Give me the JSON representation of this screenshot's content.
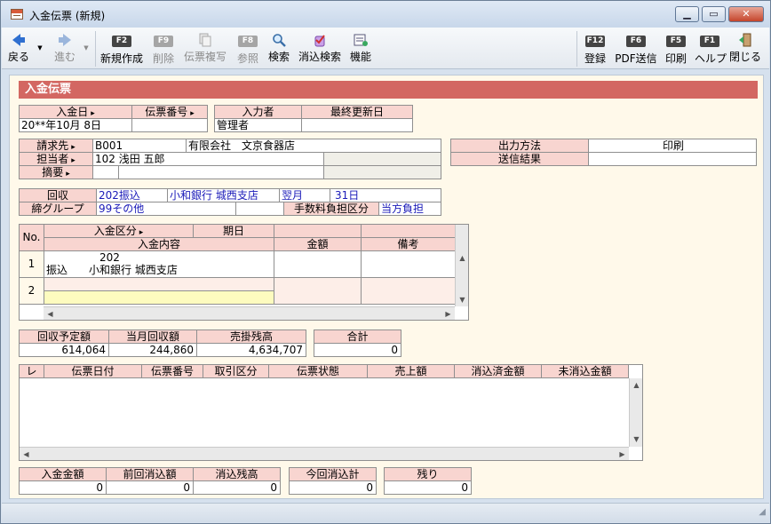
{
  "window": {
    "title": "入金伝票 (新規)"
  },
  "toolbar": {
    "back": "戻る",
    "forward": "進む",
    "new": "新規作成",
    "delete": "削除",
    "copy": "伝票複写",
    "refer": "参照",
    "search": "検索",
    "clear_search": "消込検索",
    "function": "機能",
    "register": "登録",
    "pdf": "PDF送信",
    "print": "印刷",
    "help": "ヘルプ",
    "close": "閉じる",
    "keys": {
      "new": "F2",
      "delete": "F9",
      "refer": "F8",
      "register": "F12",
      "pdf": "F6",
      "print": "F5",
      "help": "F1"
    }
  },
  "section_title": "入金伝票",
  "header": {
    "date_label": "入金日",
    "date_value": "20**年10月 8日",
    "slip_no_label": "伝票番号",
    "slip_no_value": "",
    "inputter_label": "入力者",
    "inputter_value": "管理者",
    "last_update_label": "最終更新日",
    "last_update_value": ""
  },
  "customer": {
    "billing_label": "請求先",
    "billing_code": "B001",
    "billing_name": "有限会社　文京食器店",
    "staff_label": "担当者",
    "staff_value": "102 浅田 五郎",
    "memo_label": "摘要",
    "memo_value": ""
  },
  "output": {
    "method_label": "出力方法",
    "method_value": "印刷",
    "result_label": "送信結果",
    "result_value": ""
  },
  "collection": {
    "label": "回収",
    "code": "202",
    "type": "振込",
    "bank": "小和銀行 城西支店",
    "month": "翌月",
    "day": "31",
    "day_unit": "日",
    "group_label": "締グループ",
    "group_code": "99",
    "group_name": "その他",
    "fee_label": "手数料負担区分",
    "fee_value": "当方負担"
  },
  "detail": {
    "no_label": "No.",
    "kind_label": "入金区分",
    "due_label": "期日",
    "content_label": "入金内容",
    "amount_label": "金額",
    "note_label": "備考",
    "rows": [
      {
        "no": "1",
        "code": "202",
        "type": "振込",
        "bank": "小和銀行 城西支店"
      },
      {
        "no": "2",
        "code": "",
        "type": "",
        "bank": ""
      }
    ]
  },
  "summary": {
    "planned_label": "回収予定額",
    "planned_value": "614,064",
    "month_label": "当月回収額",
    "month_value": "244,860",
    "balance_label": "売掛残高",
    "balance_value": "4,634,707",
    "total_label": "合計",
    "total_value": "0"
  },
  "reconcile": {
    "columns": [
      "レ",
      "伝票日付",
      "伝票番号",
      "取引区分",
      "伝票状態",
      "売上額",
      "消込済金額",
      "未消込金額"
    ]
  },
  "footer": {
    "deposit_label": "入金金額",
    "deposit_value": "0",
    "prev_label": "前回消込額",
    "prev_value": "0",
    "remain_label": "消込残高",
    "remain_value": "0",
    "current_label": "今回消込計",
    "current_value": "0",
    "rest_label": "残り",
    "rest_value": "0"
  },
  "colors": {
    "accent": "#d36762",
    "header_cell": "#f8d5d0",
    "client_bg": "#fff9ea",
    "highlight_row": "#fdfbbf"
  }
}
